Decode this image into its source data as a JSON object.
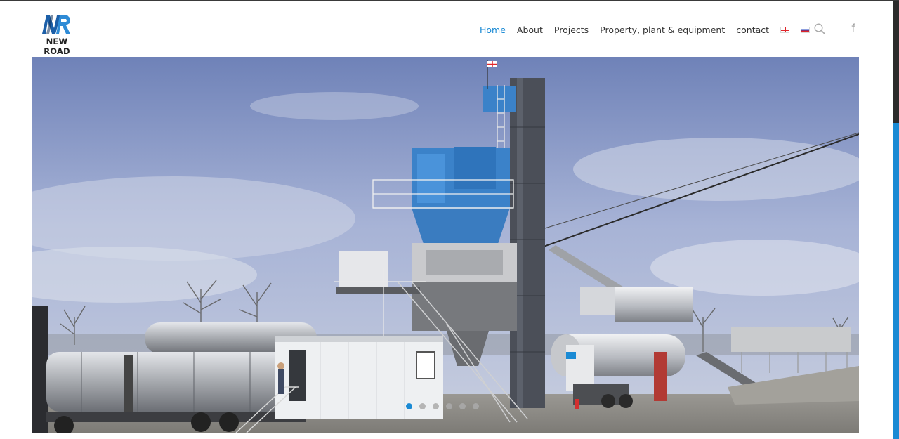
{
  "logo": {
    "text": "NEW ROAD",
    "mark": "NR"
  },
  "nav": {
    "items": [
      {
        "label": "Home",
        "active": true
      },
      {
        "label": "About",
        "active": false
      },
      {
        "label": "Projects",
        "active": false
      },
      {
        "label": "Property, plant & equipment",
        "active": false
      },
      {
        "label": "contact",
        "active": false
      }
    ],
    "languages": [
      "georgian-flag-icon",
      "russian-flag-icon"
    ]
  },
  "icons": {
    "search": "search-icon",
    "social": "facebook-icon"
  },
  "slider": {
    "slide_count": 6,
    "active_slide": 1
  },
  "colors": {
    "accent": "#1a8ad4",
    "text": "#333333",
    "plant_blue": "#3b82c9"
  }
}
